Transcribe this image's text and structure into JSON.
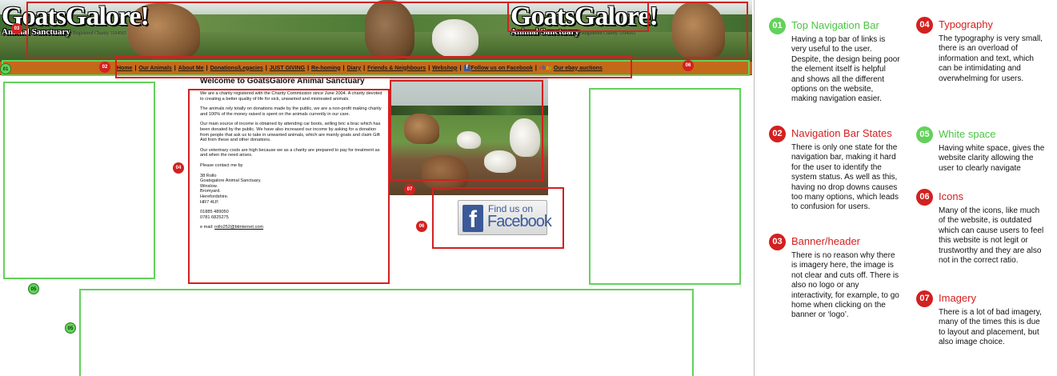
{
  "site": {
    "logo": {
      "title": "GoatsGalore!",
      "subtitle": "Animal Sanctuary",
      "registered": "Registered Charity 1104565"
    },
    "nav": [
      {
        "label": "Home"
      },
      {
        "label": "Our Animals"
      },
      {
        "label": "About Me"
      },
      {
        "label": "Donations/Legacies"
      },
      {
        "label": "JUST GIVING"
      },
      {
        "label": "Re-homing"
      },
      {
        "label": "Diary"
      },
      {
        "label": "Friends & Neighbours"
      },
      {
        "label": "Webshop"
      },
      {
        "label": "Follow us on Facebook",
        "icon": "facebook-icon"
      },
      {
        "label": "Our ebay auctions",
        "icon": "ebay-icon"
      }
    ],
    "content": {
      "heading": "Welcome to GoatsGalore Animal Sanctuary",
      "paragraphs": [
        "We are a charity registered with the Charity Commission since June 2004. A charity devoted to creating a better quality of life for sick, unwanted and mistreated animals.",
        "The animals rely totally on donations made by the public, we are a non-profit making charity and 100% of the money raised is spent on the animals currently in our care.",
        "Our main source of income is obtained by attending car boots, selling bric a brac which has been donated by the public. We have also increased our income by asking for a donation from people that ask us to take in unwanted animals, which are mainly goats and claim Gift Aid from these and other donations.",
        "Our veterinary costs are high because we as a charity are prepared to pay for treatment as and when the need arises.",
        "Please contact me by"
      ],
      "address": [
        "38 Rollo",
        "Goatsgalore Animal Sanctuary.",
        "Winslow.",
        "Bromyard.",
        "Herefordshire.",
        "HR7 4LP."
      ],
      "phones": [
        "01885 489050",
        "0781 6825275"
      ],
      "email_label": "e mail:",
      "email": "rollo252@btinternet.com"
    },
    "facebook_button": {
      "line1": "Find us on",
      "line2": "Facebook"
    }
  },
  "markers": {
    "m01": "01",
    "m02": "02",
    "m03": "03",
    "m04": "04",
    "m05": "05",
    "m06": "06",
    "m07": "07"
  },
  "legend": [
    {
      "num": "01",
      "color": "green",
      "title": "Top Navigation Bar",
      "text": "Having a top bar of links is very useful to the user. Despite, the design being poor the element itself is helpful and shows all the different options on the website, making navigation easier."
    },
    {
      "num": "02",
      "color": "red",
      "title": "Navigation Bar States",
      "text": "There is only one state for the navigation bar, making it hard for the user to identify the system status. As well as this, having no drop downs causes too many options, which leads to confusion for users."
    },
    {
      "num": "03",
      "color": "red",
      "title": "Banner/header",
      "text": "There is no reason why there is imagery here, the image is not clear and cuts off. There is also no logo or any interactivity, for example, to go home when clicking on the banner or ‘logo’."
    },
    {
      "num": "04",
      "color": "red",
      "title": "Typography",
      "text": "The typography is very small, there is an overload of information and text, which can be intimidating and overwhelming for users."
    },
    {
      "num": "05",
      "color": "green",
      "title": "White space",
      "text": "Having white space, gives the website clarity allowing the user to clearly navigate"
    },
    {
      "num": "06",
      "color": "red",
      "title": "Icons",
      "text": "Many of the icons, like much of the website, is outdated which can cause users to feel this website is not legit or trustworthy and they are also not in the correct ratio."
    },
    {
      "num": "07",
      "color": "red",
      "title": "Imagery",
      "text": "There is a lot of bad imagery, many of the times this is due to layout and placement, but also image choice."
    }
  ],
  "colors": {
    "red": "#d32020",
    "green": "#62d25a",
    "nav_bar": "#c36a1a",
    "facebook": "#3b5998"
  }
}
